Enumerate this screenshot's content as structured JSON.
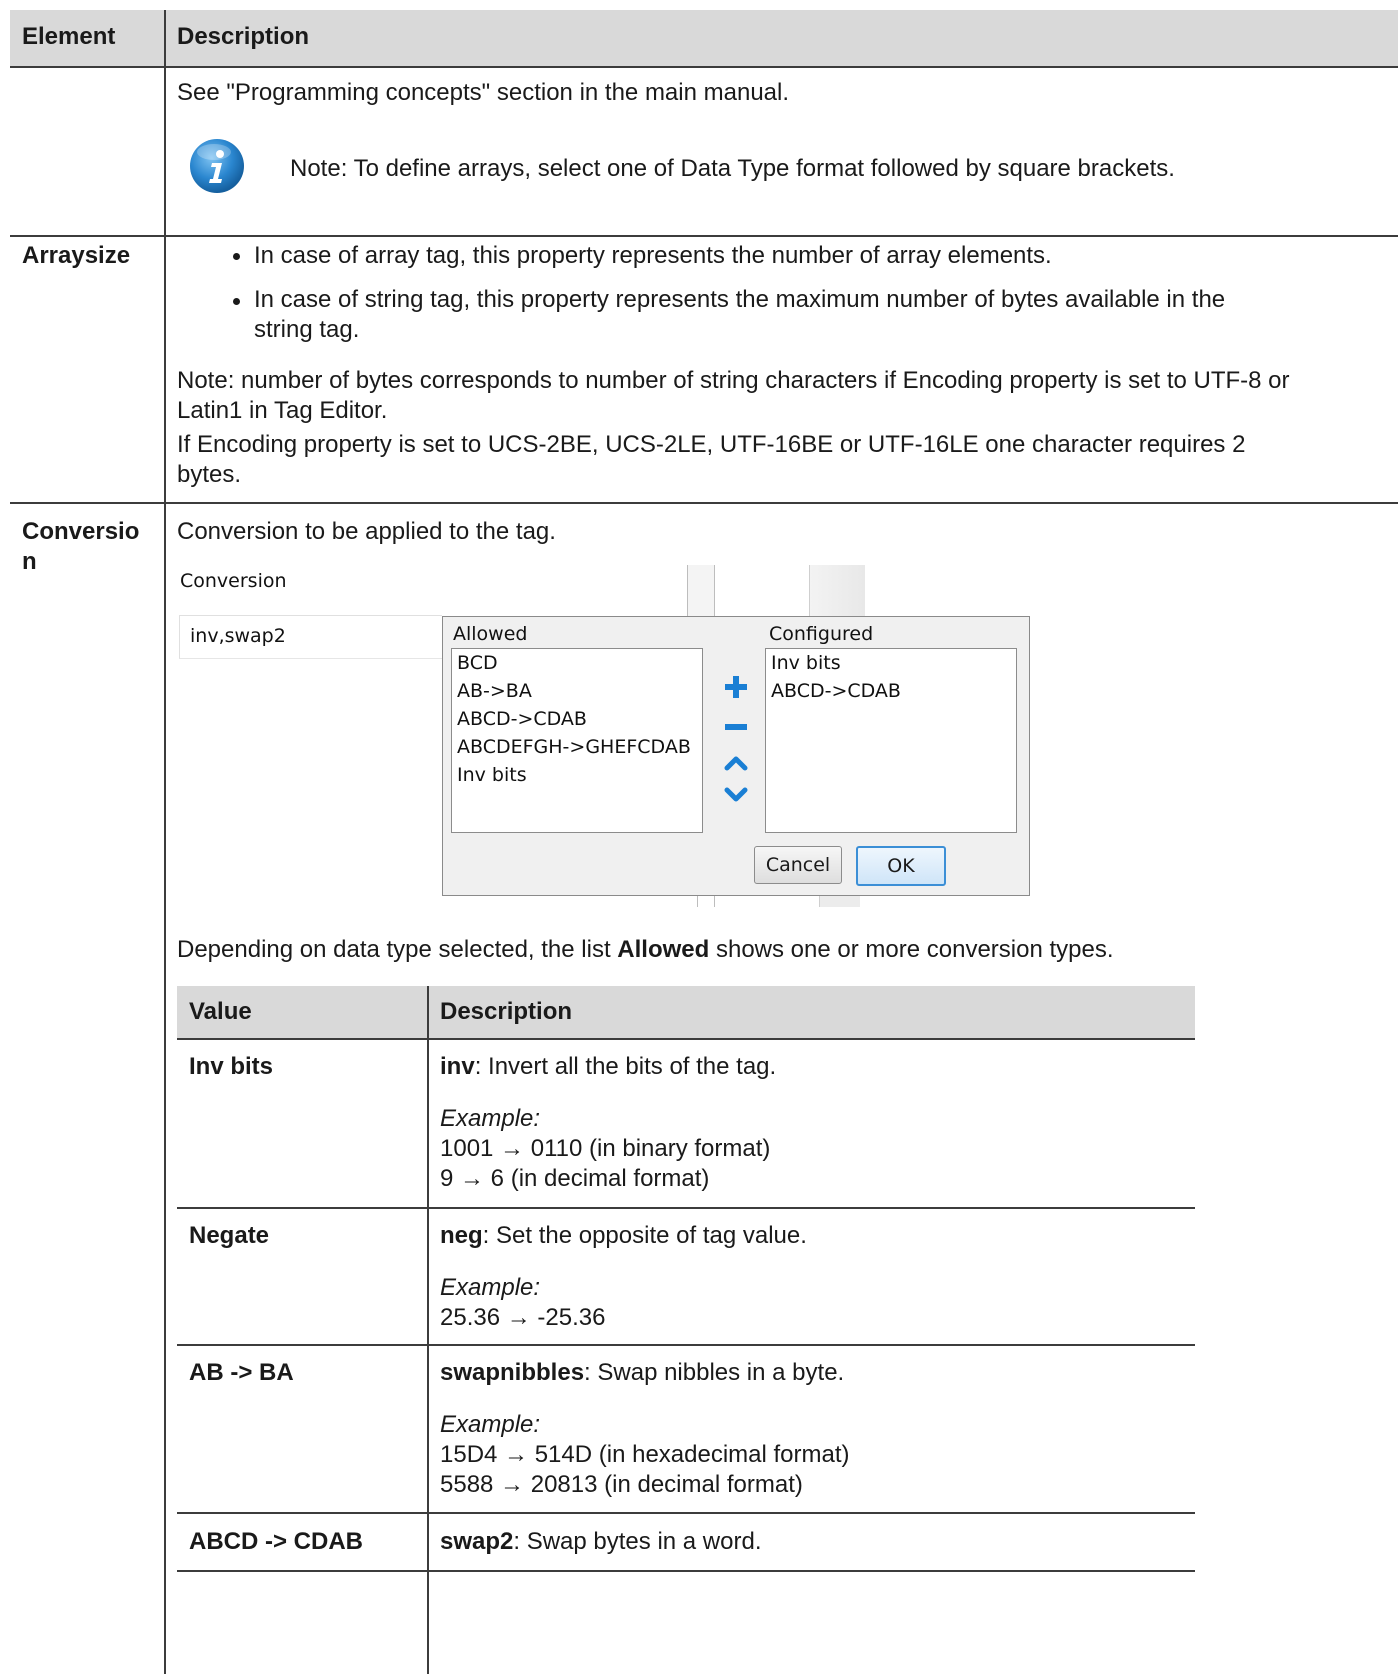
{
  "table": {
    "header": {
      "element": "Element",
      "description": "Description"
    },
    "row_datatype": {
      "text": "See \"Programming concepts\" section in the main manual.",
      "note": "Note: To define arrays, select one of Data Type format followed by square brackets."
    },
    "row_arraysize": {
      "element": "Arraysize",
      "bullet1": "In case of array tag, this property represents the number of array elements.",
      "bullet2": "In case of string tag, this property represents the maximum number of bytes available in the string tag.",
      "note_line1": "Note: number of bytes corresponds to number of string characters if Encoding property is set to UTF-8 or Latin1 in Tag Editor.",
      "note_line2": "If Encoding property is set to UCS-2BE, UCS-2LE, UTF-16BE or UTF-16LE one character requires 2 bytes."
    },
    "row_conversion": {
      "element_line1": "Conversio",
      "element_line2": "n",
      "intro": "Conversion to be applied to the tag.",
      "after_pre": "Depending on data type selected, the list ",
      "after_bold": "Allowed",
      "after_post": " shows one or more conversion types."
    }
  },
  "screenshot": {
    "field_label": "Conversion",
    "field_value": "inv,swap2",
    "allowed_label": "Allowed",
    "configured_label": "Configured",
    "allowed_items": [
      "BCD",
      "AB->BA",
      "ABCD->CDAB",
      "ABCDEFGH->GHEFCDAB",
      "Inv bits"
    ],
    "configured_items": [
      "Inv bits",
      "ABCD->CDAB"
    ],
    "cancel_label": "Cancel",
    "ok_label": "OK",
    "accent_color": "#1a7fd4"
  },
  "subtable": {
    "header": {
      "value": "Value",
      "description": "Description"
    },
    "example_label": "Example:",
    "rows": [
      {
        "value": "Inv bits",
        "keyword": "inv",
        "desc": ": Invert all the bits of the tag.",
        "ex1": "1001 → 0110 (in binary format)",
        "ex2": "9 → 6 (in decimal format)"
      },
      {
        "value": "Negate",
        "keyword": "neg",
        "desc": ": Set the opposite of tag value.",
        "ex1": "25.36 → -25.36"
      },
      {
        "value": "AB -> BA",
        "keyword": "swapnibbles",
        "desc": ": Swap nibbles in a byte.",
        "ex1": "15D4 → 514D (in hexadecimal format)",
        "ex2": "5588 → 20813 (in decimal format)"
      },
      {
        "value": "ABCD -> CDAB",
        "keyword": "swap2",
        "desc": ": Swap bytes in a word."
      }
    ]
  }
}
